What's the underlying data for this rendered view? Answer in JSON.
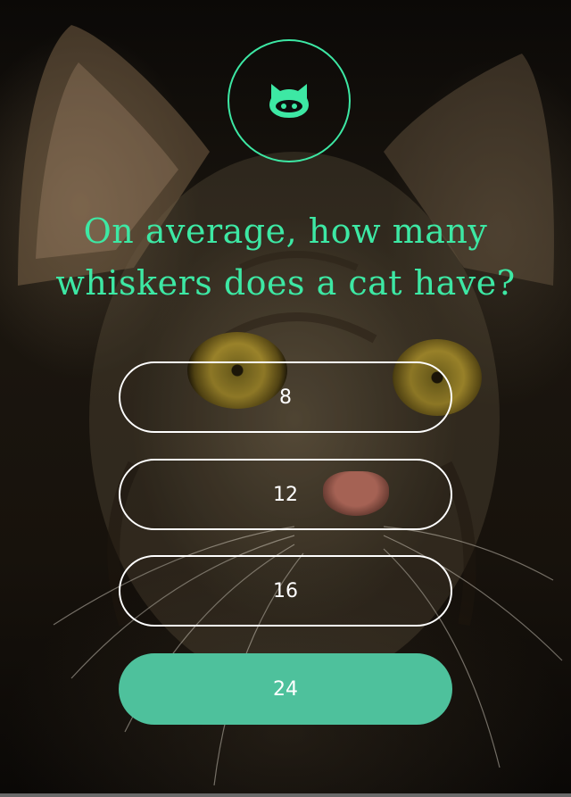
{
  "logo": {
    "icon": "cat-face-icon",
    "accent": "#3de8a4"
  },
  "question": {
    "line1": "On average, how many",
    "line2": "whiskers does a cat have?"
  },
  "answers": [
    {
      "label": "8",
      "selected": false
    },
    {
      "label": "12",
      "selected": false
    },
    {
      "label": "16",
      "selected": false
    },
    {
      "label": "24",
      "selected": true
    }
  ],
  "colors": {
    "accent": "#3de8a4",
    "selected_fill": "#4ec19c",
    "outline": "#ffffff"
  }
}
